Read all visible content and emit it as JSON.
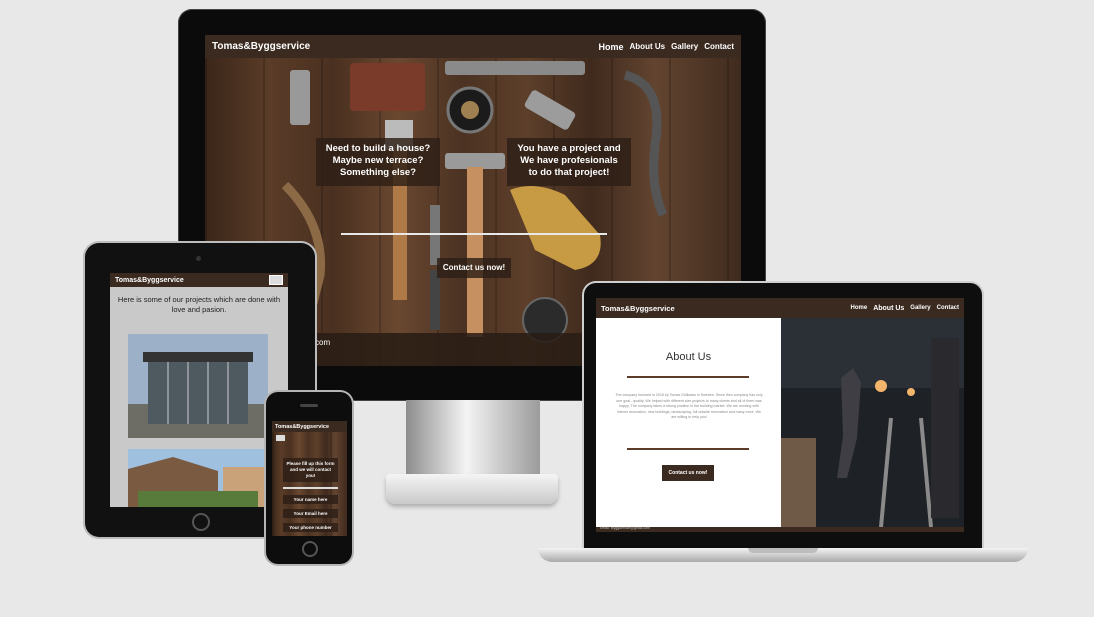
{
  "brand": "Tomas&Byggservice",
  "nav": {
    "home": "Home",
    "about": "About Us",
    "gallery": "Gallery",
    "contact": "Contact"
  },
  "monitor": {
    "box_left": "Need to build a house?\nMaybe new terrace?\nSomething else?",
    "box_right": "You have a project and\nWe have profesionals\nto do that project!",
    "cta": "Contact us now!",
    "footer_fragment": "com"
  },
  "tablet": {
    "heading": "Here is some of our projects which are done with love and pasion."
  },
  "phone": {
    "form_title": "Please fill up this form and we will contact you!",
    "name_placeholder": "Your name here",
    "email_placeholder": "Your Email here",
    "phone_placeholder": "Your phone number"
  },
  "laptop": {
    "about_title": "About Us",
    "about_text": "The company founded in 2016 by Tomas Grilikstas in Sweden. Since then company has only one goal - quality. We helped with different size projects to many clients and all of them was happy. The company takes a strong position in the building market. We are working with interior renovation, new buildings, landscaping, full outside renovation and many more. We are willing to help you!",
    "cta": "Contact us now!",
    "footer_email": "Email: tbyggservice@gmail.com"
  },
  "colors": {
    "nav": "#3b2a20",
    "background": "#e8e8e8",
    "overlay": "#2d1e16"
  }
}
